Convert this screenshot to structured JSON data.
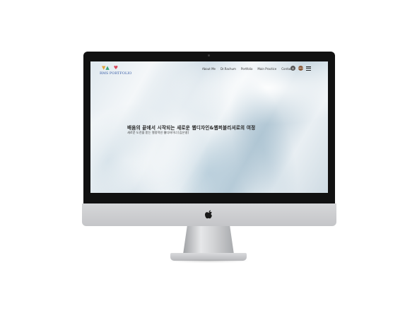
{
  "site": {
    "logo_text": "RMS PORTFOLIO",
    "nav": [
      "About Me",
      "Dr.Rachum",
      "Portfolio",
      "Main Practice",
      "Contact"
    ],
    "icons": [
      "globe-icon",
      "chat-icon",
      "hamburger-menu-icon"
    ],
    "hero": {
      "title": "배움의 끝에서 시작되는 새로운 웹디자인&웹퍼블리셔로의 여정",
      "subtitle": "새로운 도전을 받는 열정적인 웹디자이너 [김은영]"
    }
  },
  "colors": {
    "bezel": "#111111",
    "body_aluminum": "#d6d7d9",
    "logo_blue": "#3a5ea8",
    "hero_text": "#222222"
  }
}
